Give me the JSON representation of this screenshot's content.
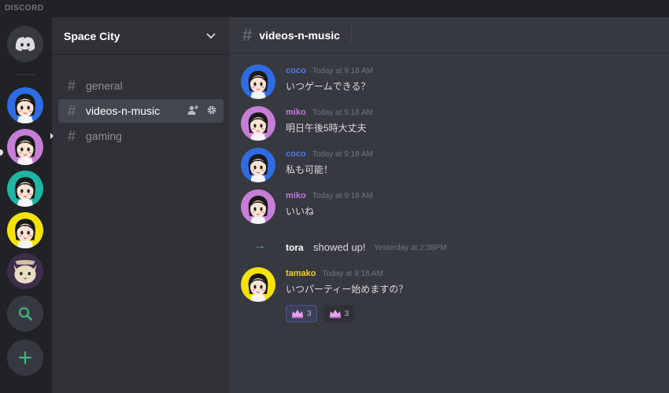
{
  "app": {
    "brand": "DISCORD"
  },
  "colors": {
    "rail_bg": "#202225",
    "sidebar_bg": "#2f3136",
    "chat_bg": "#36393f",
    "blurple": "#7289da",
    "green": "#43b581",
    "coco": "#4f7ef0",
    "miko": "#c27ae0",
    "tamako": "#f0d028"
  },
  "servers": [
    {
      "name": "home",
      "icon": "discord-logo-icon"
    },
    {
      "name": "server-1",
      "icon": "girl-avatar-icon"
    },
    {
      "name": "server-2",
      "icon": "girl-avatar-icon"
    },
    {
      "name": "server-3",
      "icon": "girl-avatar-icon"
    },
    {
      "name": "server-4",
      "icon": "girl-avatar-icon"
    },
    {
      "name": "server-5",
      "icon": "cat-icon"
    },
    {
      "name": "explore",
      "icon": "search-icon"
    },
    {
      "name": "add-server",
      "icon": "plus-icon"
    }
  ],
  "sidebar": {
    "server_name": "Space City",
    "channels": [
      {
        "name": "general"
      },
      {
        "name": "videos-n-music"
      },
      {
        "name": "gaming"
      }
    ]
  },
  "chat": {
    "channel_title": "videos-n-music",
    "messages": [
      {
        "author": "coco",
        "time": "Today at 9:18 AM",
        "text": "いつゲームできる？"
      },
      {
        "author": "miko",
        "time": "Today at 9:18 AM",
        "text": "明日午後5時大丈夫"
      },
      {
        "author": "coco",
        "time": "Today at 9:18 AM",
        "text": "私も可能！"
      },
      {
        "author": "miko",
        "time": "Today at 9:18 AM",
        "text": "いいね"
      }
    ],
    "system": {
      "user": "tora",
      "action": "showed up!",
      "time": "Yesterday at 2:38PM"
    },
    "last_message": {
      "author": "tamako",
      "time": "Today at 9:18 AM",
      "text": "いつパーティー始めますの？"
    },
    "reactions": [
      {
        "emoji": "crown-icon",
        "count": "3"
      },
      {
        "emoji": "crown-icon",
        "count": "3"
      }
    ]
  }
}
